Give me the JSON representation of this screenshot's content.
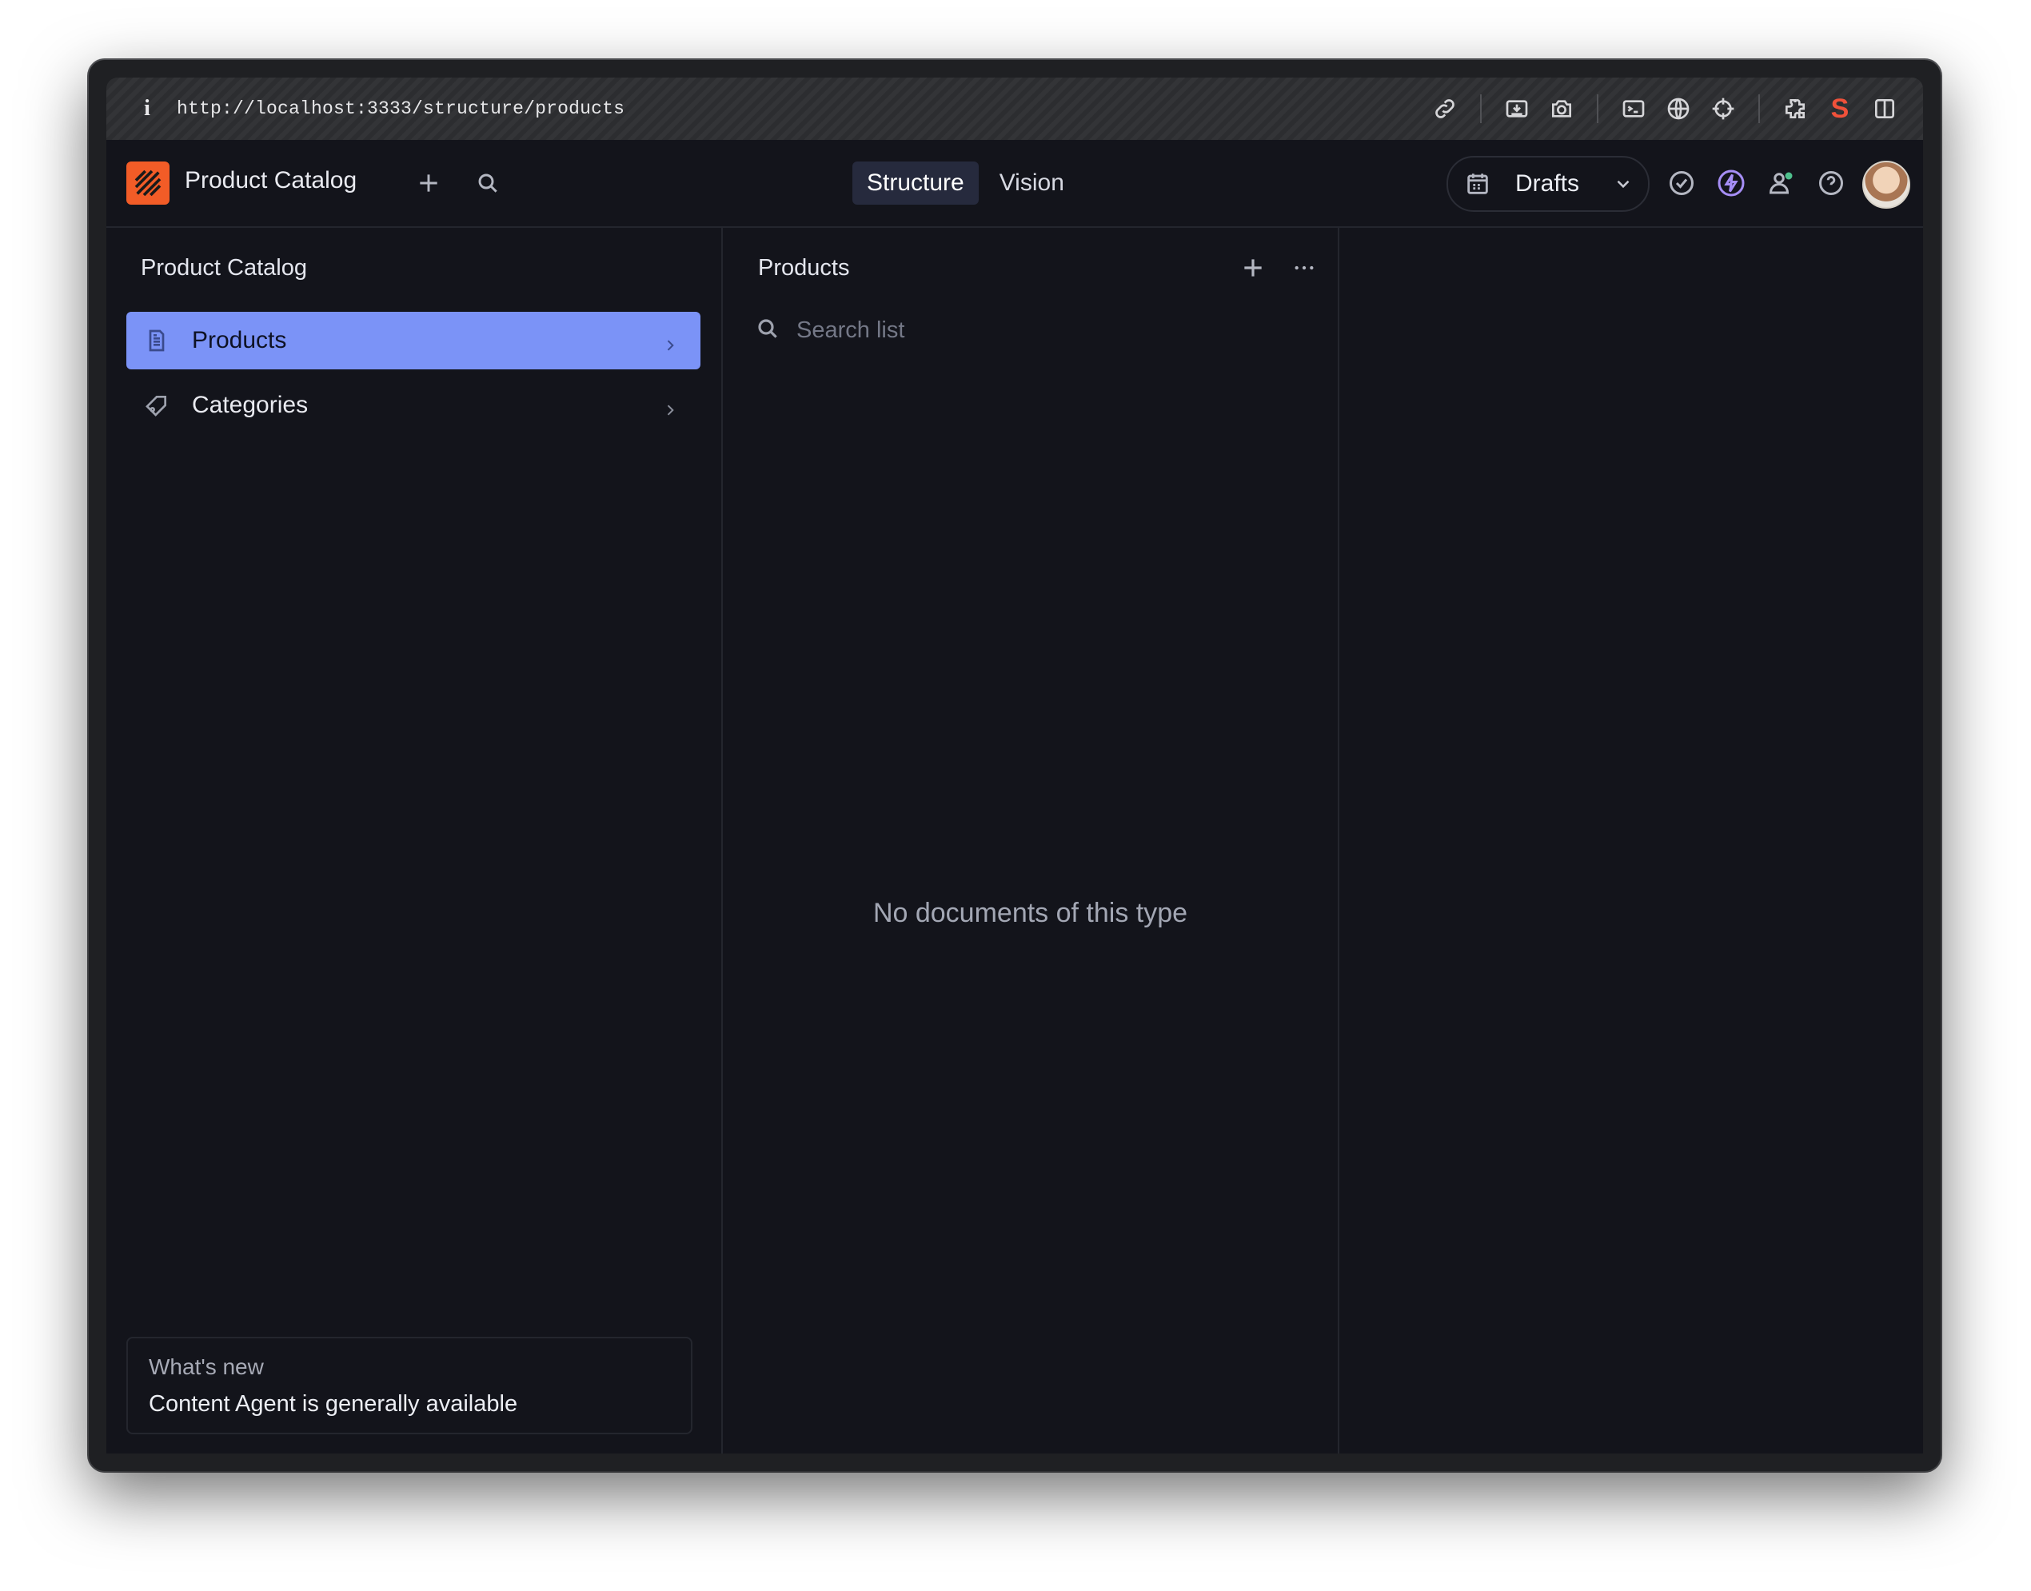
{
  "browser": {
    "url": "http://localhost:3333/structure/products",
    "tool_icons": [
      "link-icon",
      "download-icon",
      "camera-icon",
      "terminal-icon",
      "globe-icon",
      "crosshair-icon",
      "extensions-icon",
      "sanity-s-icon",
      "split-view-icon"
    ],
    "s_label": "S"
  },
  "header": {
    "app_title": "Product Catalog",
    "tabs": [
      {
        "label": "Structure",
        "active": true
      },
      {
        "label": "Vision",
        "active": false
      }
    ],
    "perspective": "Drafts"
  },
  "sidebar": {
    "title": "Product Catalog",
    "items": [
      {
        "label": "Products",
        "icon": "document-icon",
        "selected": true
      },
      {
        "label": "Categories",
        "icon": "tag-icon",
        "selected": false
      }
    ],
    "whats_new": {
      "title": "What's new",
      "text": "Content Agent is generally available"
    }
  },
  "list_pane": {
    "title": "Products",
    "search_placeholder": "Search list",
    "empty_text": "No documents of this type"
  },
  "colors": {
    "accent": "#7b93f7",
    "logo": "#f25c27",
    "background": "#13141b"
  }
}
